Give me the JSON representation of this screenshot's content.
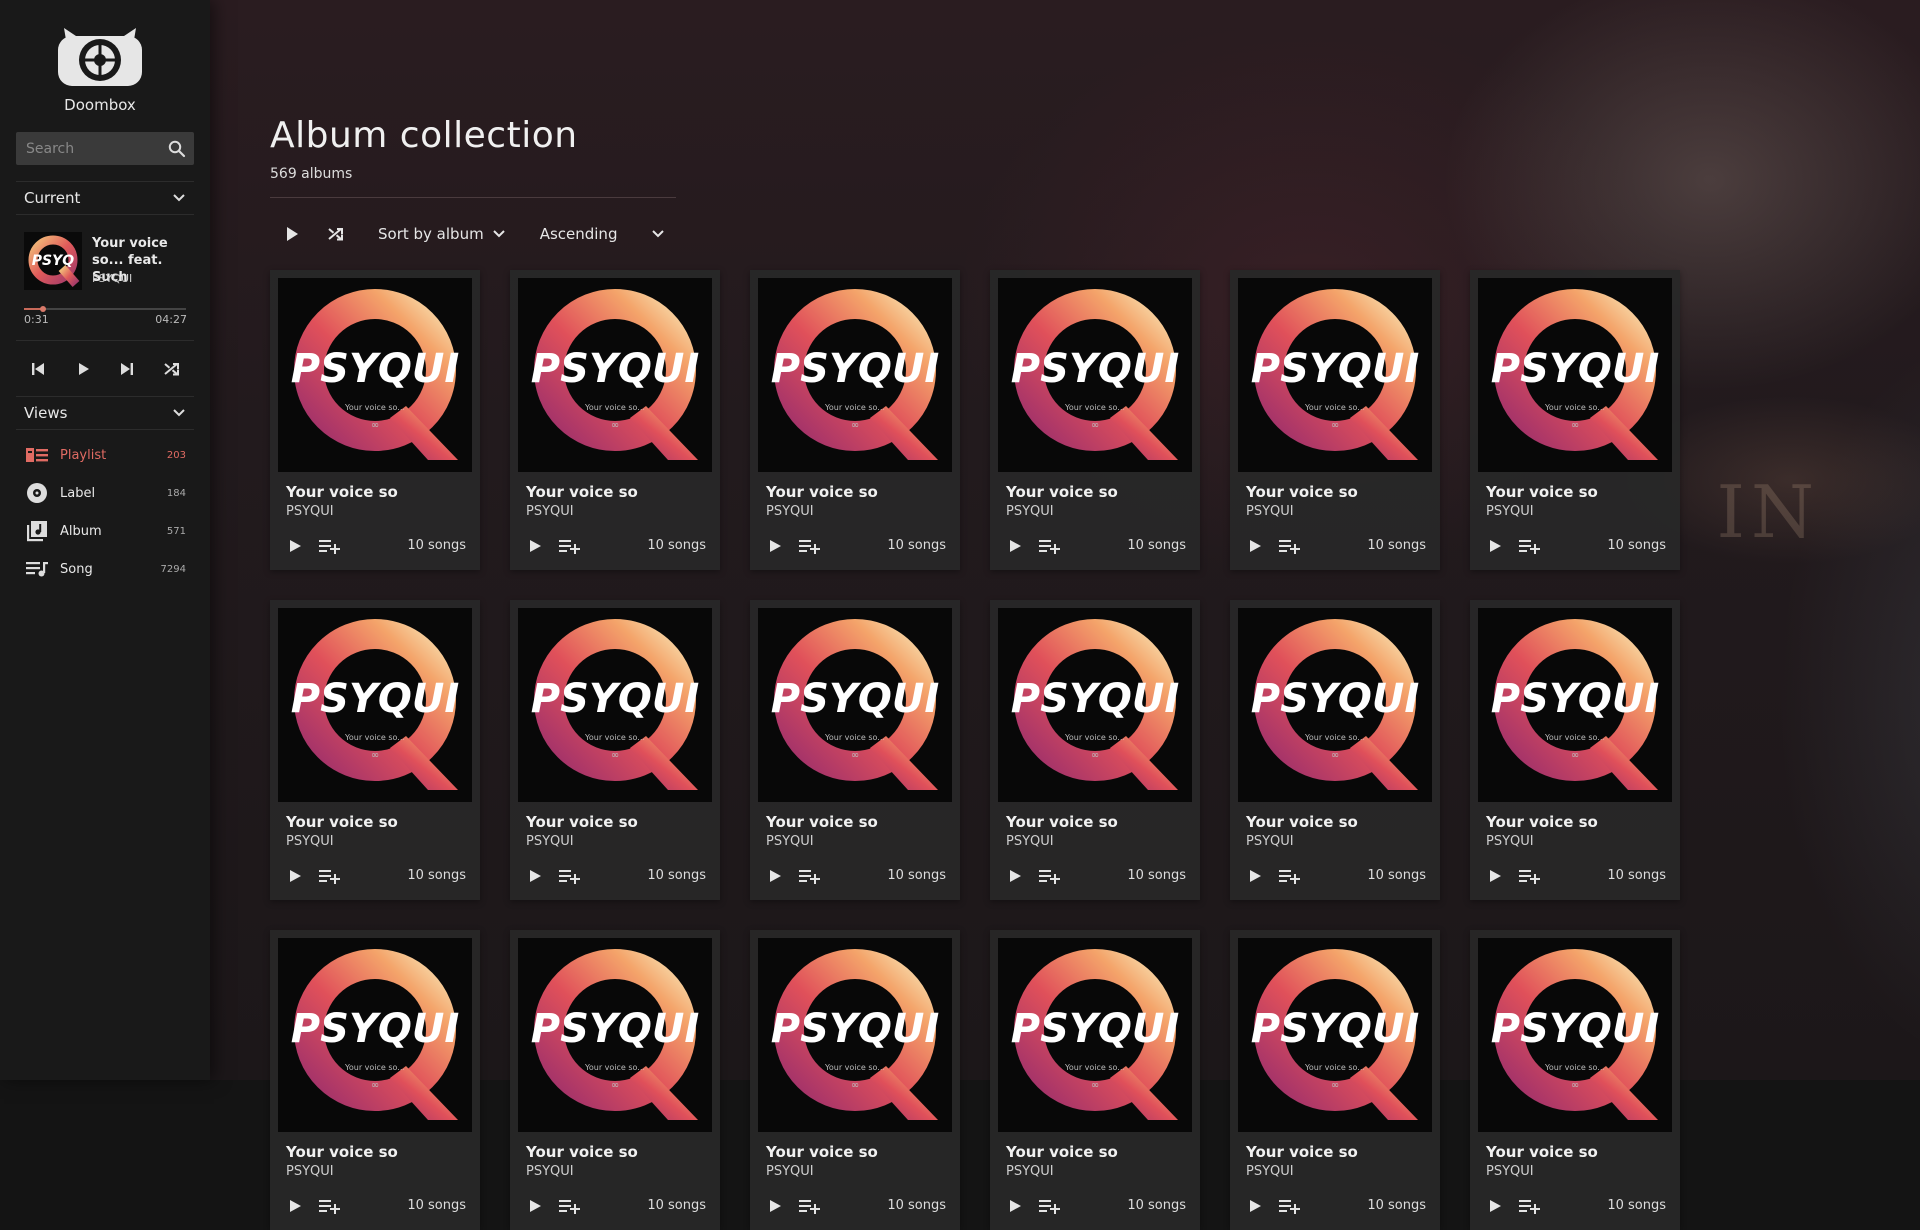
{
  "app": {
    "name": "Doombox"
  },
  "search": {
    "placeholder": "Search"
  },
  "current": {
    "header": "Current",
    "title": "Your voice so... feat. Such",
    "artist": "PSYQUI",
    "elapsed": "0:31",
    "duration": "04:27",
    "progress": 0.116
  },
  "views": {
    "header": "Views",
    "items": [
      {
        "label": "Playlist",
        "count": "203",
        "icon": "playlist-icon",
        "active": true
      },
      {
        "label": "Label",
        "count": "184",
        "icon": "label-icon",
        "active": false
      },
      {
        "label": "Album",
        "count": "571",
        "icon": "album-icon",
        "active": false
      },
      {
        "label": "Song",
        "count": "7294",
        "icon": "song-icon",
        "active": false
      }
    ]
  },
  "main": {
    "title": "Album collection",
    "subtitle": "569 albums",
    "sort_label": "Sort by album",
    "order_label": "Ascending"
  },
  "album": {
    "title": "Your voice so",
    "artist": "PSYQUI",
    "songs": "10 songs",
    "cover_text": "PSYQUI",
    "cover_sub": "Your voice so...",
    "cover_mark": "∞"
  },
  "colors": {
    "accent": "#e06b63",
    "sidebar": "#191919",
    "card": "#282828",
    "search_bg": "#3a3a3a"
  }
}
